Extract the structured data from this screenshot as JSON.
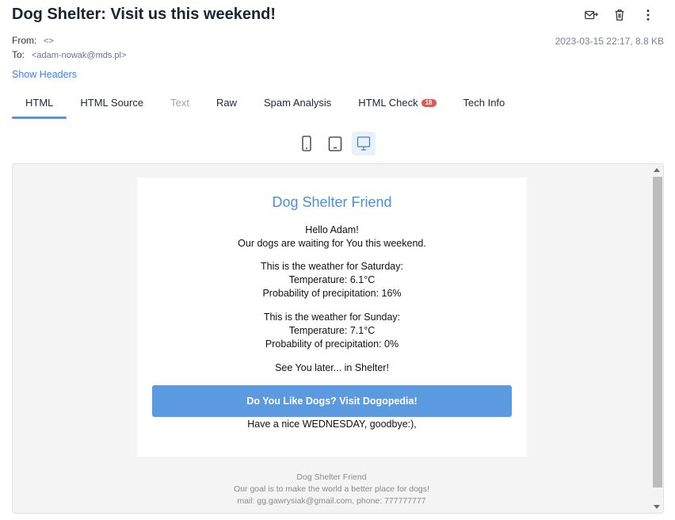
{
  "email": {
    "subject": "Dog Shelter: Visit us this weekend!",
    "from_label": "From:",
    "from_value": "<>",
    "to_label": "To:",
    "to_value": "<adam-nowak@mds.pl>",
    "meta": "2023-03-15 22:17, 8.8 KB",
    "show_headers": "Show Headers"
  },
  "actions": {
    "forward_icon": "envelope-forward-icon",
    "delete_icon": "trash-icon",
    "more_icon": "kebab-menu-icon"
  },
  "tabs": [
    {
      "label": "HTML",
      "active": true
    },
    {
      "label": "HTML Source"
    },
    {
      "label": "Text",
      "disabled": true
    },
    {
      "label": "Raw"
    },
    {
      "label": "Spam Analysis"
    },
    {
      "label": "HTML Check",
      "badge": "18"
    },
    {
      "label": "Tech Info"
    }
  ],
  "devices": [
    "phone-icon",
    "tablet-icon",
    "desktop-icon"
  ],
  "body": {
    "brand": "Dog Shelter Friend",
    "greeting": "Hello Adam!",
    "intro": "Our dogs are waiting for You this weekend.",
    "sat_title": "This is the weather for Saturday:",
    "sat_temp": "Temperature: 6.1°C",
    "sat_precip": "Probability of precipitation: 16%",
    "sun_title": "This is the weather for Sunday:",
    "sun_temp": "Temperature: 7.1°C",
    "sun_precip": "Probability of precipitation: 0%",
    "see_you": "See You later... in Shelter!",
    "cta": "Do You Like Dogs? Visit Dogopedia!",
    "closing": "Have a nice WEDNESDAY, goodbye:),"
  },
  "footer": {
    "name": "Dog Shelter Friend",
    "goal": "Our goal is to make the world a better place for dogs!",
    "contact": "mail: gg.gawrysiak@gmail.com, phone: 777777777"
  },
  "colors": {
    "accent": "#5a8ef5",
    "brand": "#4a8fda",
    "cta": "#5b9ade",
    "badge": "#e25555"
  }
}
